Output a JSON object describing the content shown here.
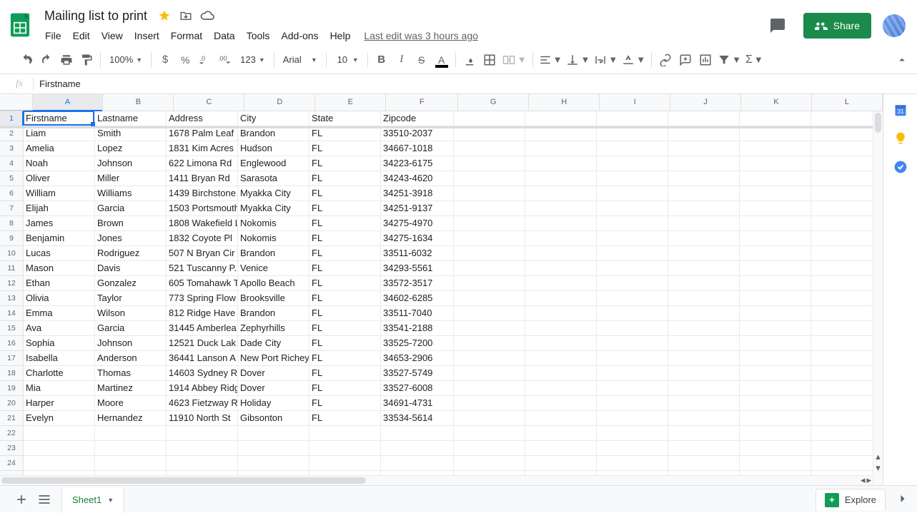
{
  "doc": {
    "title": "Mailing list to print"
  },
  "menu": {
    "items": [
      "File",
      "Edit",
      "View",
      "Insert",
      "Format",
      "Data",
      "Tools",
      "Add-ons",
      "Help"
    ],
    "last_edit": "Last edit was 3 hours ago"
  },
  "header": {
    "share_label": "Share"
  },
  "toolbar": {
    "zoom": "100%",
    "more_formats": "123",
    "font": "Arial",
    "font_size": "10"
  },
  "formula": {
    "value": "Firstname"
  },
  "columns": [
    {
      "letter": "A",
      "width": 100
    },
    {
      "letter": "B",
      "width": 100
    },
    {
      "letter": "C",
      "width": 100
    },
    {
      "letter": "D",
      "width": 100
    },
    {
      "letter": "E",
      "width": 100
    },
    {
      "letter": "F",
      "width": 102
    },
    {
      "letter": "G",
      "width": 100
    },
    {
      "letter": "H",
      "width": 100
    },
    {
      "letter": "I",
      "width": 100
    },
    {
      "letter": "J",
      "width": 100
    },
    {
      "letter": "K",
      "width": 100
    },
    {
      "letter": "L",
      "width": 100
    }
  ],
  "row_count": 25,
  "data_rows": [
    [
      "Firstname",
      "Lastname",
      "Address",
      "City",
      "State",
      "Zipcode"
    ],
    [
      "Liam",
      "Smith",
      "1678 Palm Leaf",
      "Brandon",
      "FL",
      "33510-2037"
    ],
    [
      "Amelia",
      "Lopez",
      "1831 Kim Acres",
      "Hudson",
      "FL",
      "34667-1018"
    ],
    [
      "Noah",
      "Johnson",
      "622 Limona Rd",
      "Englewood",
      "FL",
      "34223-6175"
    ],
    [
      "Oliver",
      "Miller",
      "1411 Bryan Rd",
      "Sarasota",
      "FL",
      "34243-4620"
    ],
    [
      "William",
      "Williams",
      "1439 Birchstone",
      "Myakka City",
      "FL",
      "34251-3918"
    ],
    [
      "Elijah",
      "Garcia",
      "1503 Portsmouth",
      "Myakka City",
      "FL",
      "34251-9137"
    ],
    [
      "James",
      "Brown",
      "1808 Wakefield L",
      "Nokomis",
      "FL",
      "34275-4970"
    ],
    [
      "Benjamin",
      "Jones",
      "1832 Coyote Pl",
      "Nokomis",
      "FL",
      "34275-1634"
    ],
    [
      "Lucas",
      "Rodriguez",
      "507 N Bryan Cir",
      "Brandon",
      "FL",
      "33511-6032"
    ],
    [
      "Mason",
      "Davis",
      "521 Tuscanny P.",
      "Venice",
      "FL",
      "34293-5561"
    ],
    [
      "Ethan",
      "Gonzalez",
      "605 Tomahawk T",
      "Apollo Beach",
      "FL",
      "33572-3517"
    ],
    [
      "Olivia",
      "Taylor",
      "773 Spring Flow",
      "Brooksville",
      "FL",
      "34602-6285"
    ],
    [
      "Emma",
      "Wilson",
      "812 Ridge Have",
      "Brandon",
      "FL",
      "33511-7040"
    ],
    [
      "Ava",
      "Garcia",
      "31445 Amberlea",
      "Zephyrhills",
      "FL",
      "33541-2188"
    ],
    [
      "Sophia",
      "Johnson",
      "12521 Duck Lak",
      "Dade City",
      "FL",
      "33525-7200"
    ],
    [
      "Isabella",
      "Anderson",
      "36441 Lanson A",
      "New Port Richey",
      "FL",
      "34653-2906"
    ],
    [
      "Charlotte",
      "Thomas",
      "14603 Sydney R",
      "Dover",
      "FL",
      "33527-5749"
    ],
    [
      "Mia",
      "Martinez",
      "1914 Abbey Ridg",
      "Dover",
      "FL",
      "33527-6008"
    ],
    [
      "Harper",
      "Moore",
      "4623 Fietzway R",
      "Holiday",
      "FL",
      "34691-4731"
    ],
    [
      "Evelyn",
      "Hernandez",
      "11910 North St",
      "Gibsonton",
      "FL",
      "33534-5614"
    ]
  ],
  "sheetbar": {
    "tab_name": "Sheet1",
    "explore": "Explore"
  }
}
